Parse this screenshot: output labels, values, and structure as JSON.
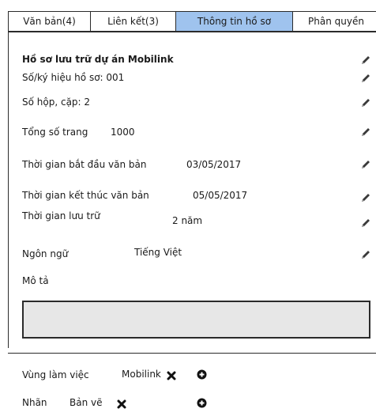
{
  "tabs": [
    {
      "label": "Văn bản(4)"
    },
    {
      "label": "Liên kết(3)"
    },
    {
      "label": "Thông tin hồ sơ"
    },
    {
      "label": "Phân quyền"
    }
  ],
  "record": {
    "title": "Hồ sơ lưu trữ dự án Mobilink",
    "code": "Số/ký hiệu hồ sơ: 001",
    "box": "Số hộp, cặp: 2",
    "pages_label": "Tổng số trang",
    "pages_value": "1000",
    "start_label": "Thời gian bắt đầu văn bản",
    "start_value": "03/05/2017",
    "end_label": "Thời gian kết thúc văn bản",
    "end_value": "05/05/2017",
    "retention_label": "Thời gian lưu trữ",
    "retention_value": "2 năm",
    "language_label": "Ngôn ngữ",
    "language_value": "Tiếng Việt",
    "description_label": "Mô tả",
    "description_value": ""
  },
  "footer": {
    "workspace_label": "Vùng làm việc",
    "workspace_value": "Mobilink",
    "tag_label": "Nhãn",
    "tag_value": "Bản vẽ"
  }
}
